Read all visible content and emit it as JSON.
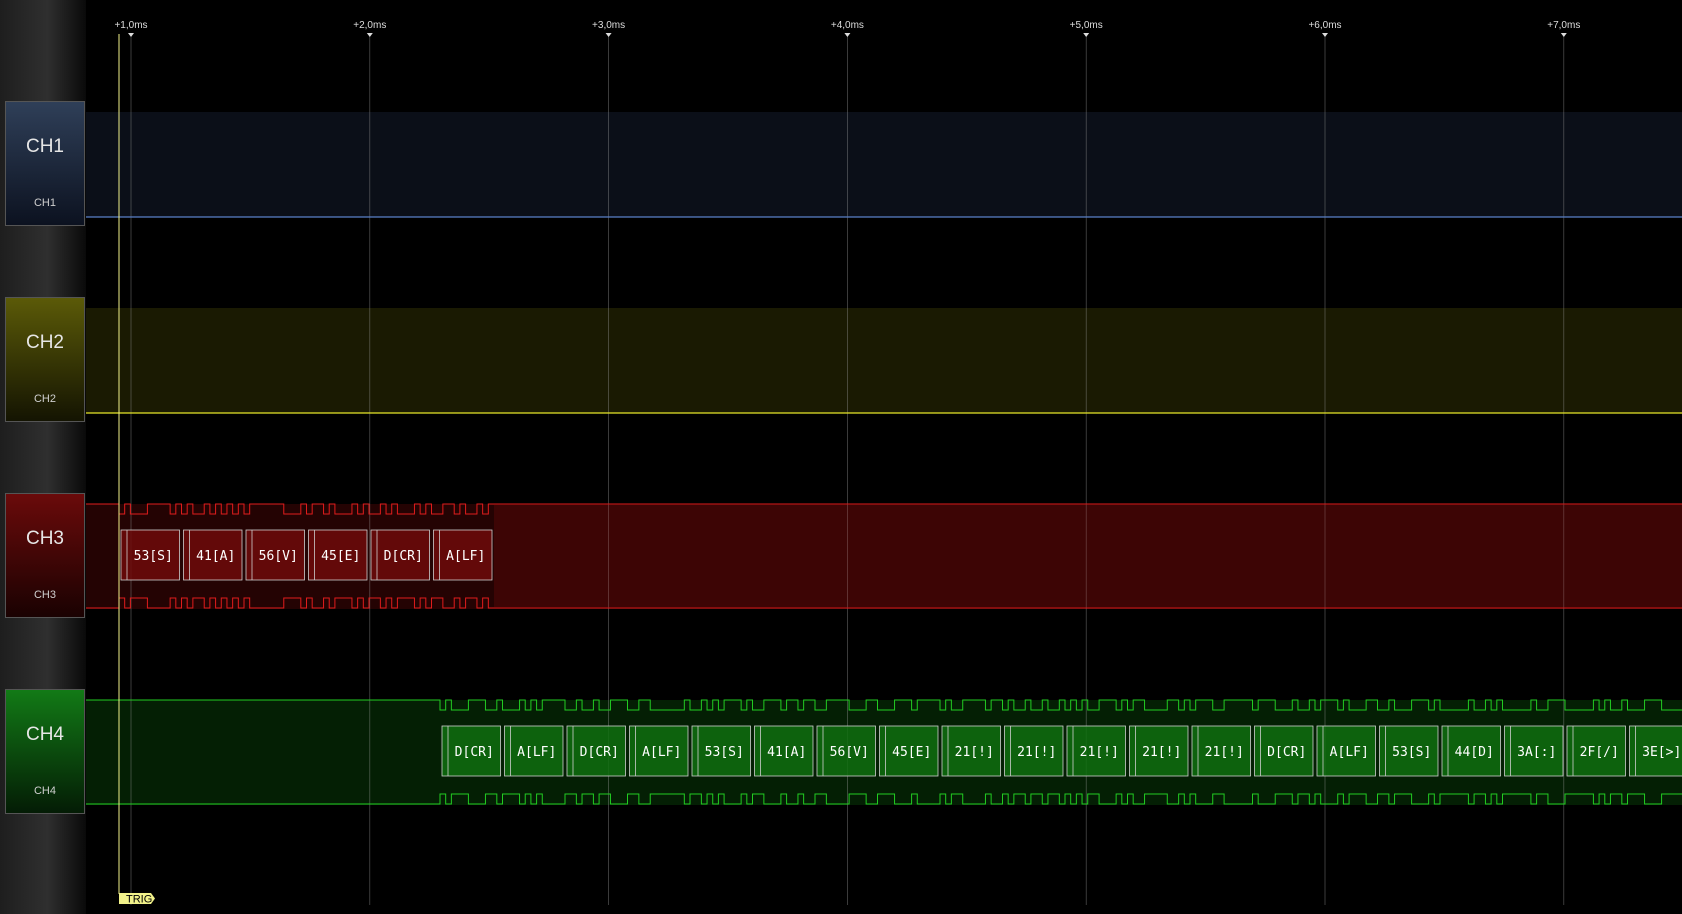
{
  "channels": [
    {
      "name": "CH1",
      "sub": "CH1",
      "color": "#5a80c8"
    },
    {
      "name": "CH2",
      "sub": "CH2",
      "color": "#e6e62a"
    },
    {
      "name": "CH3",
      "sub": "CH3",
      "color": "#e01c1c"
    },
    {
      "name": "CH4",
      "sub": "CH4",
      "color": "#22cc22"
    }
  ],
  "timebase": {
    "ticks": [
      "+1,0ms",
      "+2,0ms",
      "+3,0ms",
      "+4,0ms",
      "+5,0ms",
      "+6,0ms",
      "+7,0ms"
    ]
  },
  "trigger": {
    "label": "TRIG",
    "color": "#f2f28a"
  },
  "decode": {
    "ch3": [
      "53[S]",
      "41[A]",
      "56[V]",
      "45[E]",
      "D[CR]",
      "A[LF]"
    ],
    "ch4": [
      "D[CR]",
      "A[LF]",
      "D[CR]",
      "A[LF]",
      "53[S]",
      "41[A]",
      "56[V]",
      "45[E]",
      "21[!]",
      "21[!]",
      "21[!]",
      "21[!]",
      "21[!]",
      "D[CR]",
      "A[LF]",
      "53[S]",
      "44[D]",
      "3A[:]",
      "2F[/]",
      "3E[>]"
    ]
  }
}
